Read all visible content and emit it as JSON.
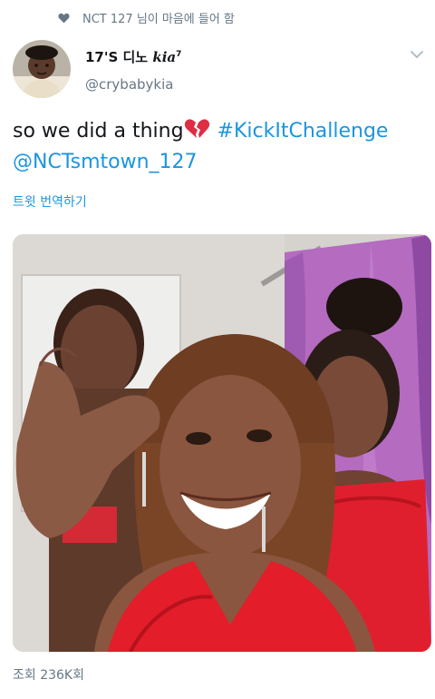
{
  "social_context": {
    "text": "NCT 127 님이 마음에 들어 함",
    "icon": "heart-icon"
  },
  "author": {
    "display_name": "17'S 디노",
    "display_name_emph": "kia",
    "display_name_sup": "7",
    "handle": "@crybabykia"
  },
  "tweet": {
    "text_before": "so we did a thing",
    "emoji": "broken-heart-icon",
    "hashtag": "#KickItChallenge",
    "mention": "@NCTsmtown_127",
    "translate_label": "트윗 번역하기"
  },
  "stats": {
    "views_label": "조회 236K회"
  },
  "colors": {
    "link": "#1b95e0",
    "secondary": "#657786",
    "primary": "#14171a"
  }
}
